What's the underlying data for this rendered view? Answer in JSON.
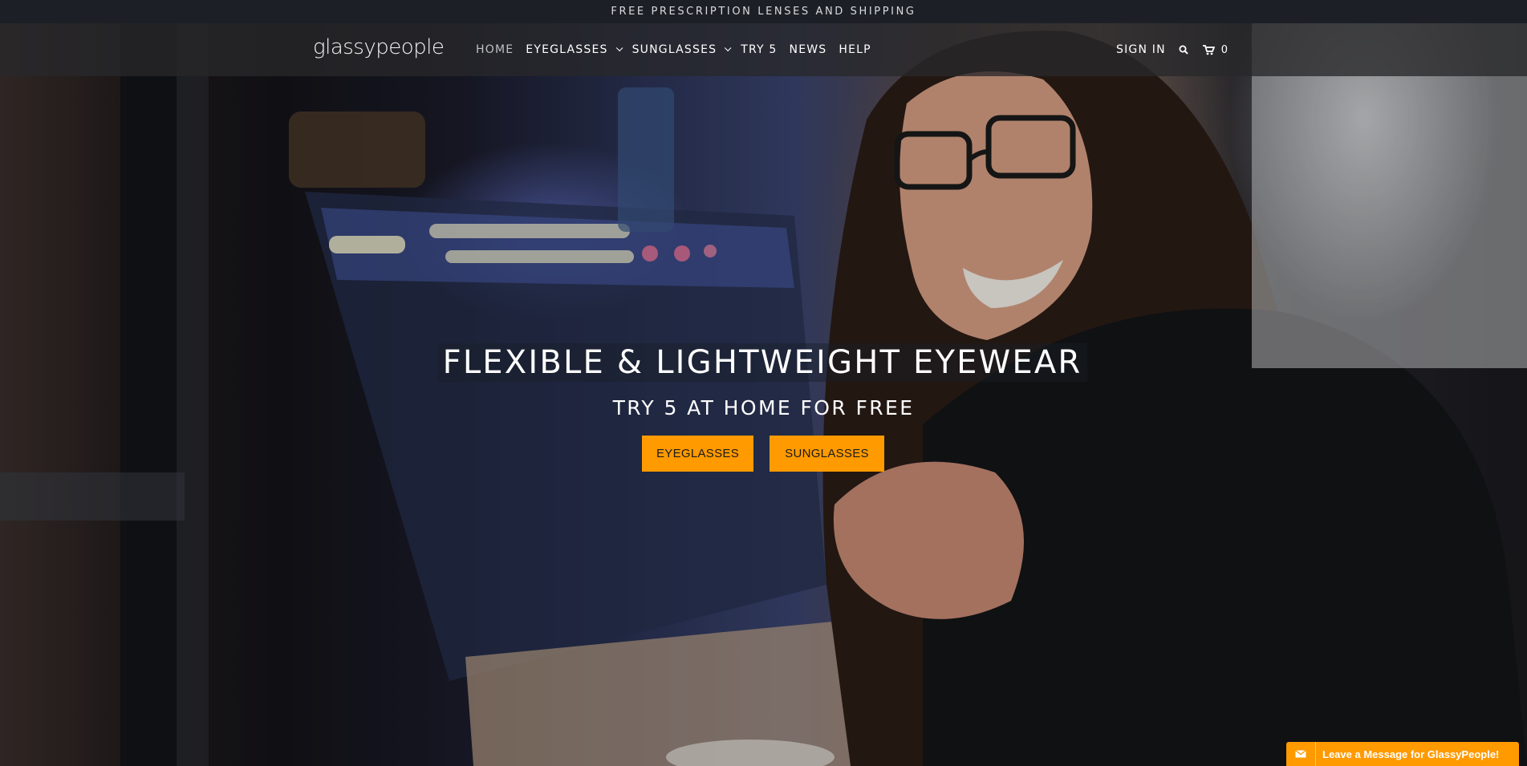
{
  "announcement": "FREE PRESCRIPTION LENSES AND SHIPPING",
  "header": {
    "logo_text": "glassypeople",
    "nav": [
      {
        "label": "HOME",
        "active": true,
        "dropdown": false
      },
      {
        "label": "EYEGLASSES",
        "active": false,
        "dropdown": true
      },
      {
        "label": "SUNGLASSES",
        "active": false,
        "dropdown": true
      },
      {
        "label": "TRY 5",
        "active": false,
        "dropdown": false
      },
      {
        "label": "NEWS",
        "active": false,
        "dropdown": false
      },
      {
        "label": "HELP",
        "active": false,
        "dropdown": false
      }
    ],
    "sign_in": "SIGN IN",
    "search_icon": "search-icon",
    "cart_icon": "cart-icon",
    "cart_count": "0"
  },
  "hero": {
    "headline": "FLEXIBLE & LIGHTWEIGHT EYEWEAR",
    "subhead": "TRY 5 AT HOME FOR FREE",
    "buttons": {
      "eyeglasses": "EYEGLASSES",
      "sunglasses": "SUNGLASSES"
    }
  },
  "chat": {
    "label": "Leave a Message for GlassyPeople!",
    "icon": "envelope-icon"
  },
  "colors": {
    "accent": "#ff9a00",
    "announcement_bg": "#1c2026",
    "header_bg": "#28282a"
  }
}
